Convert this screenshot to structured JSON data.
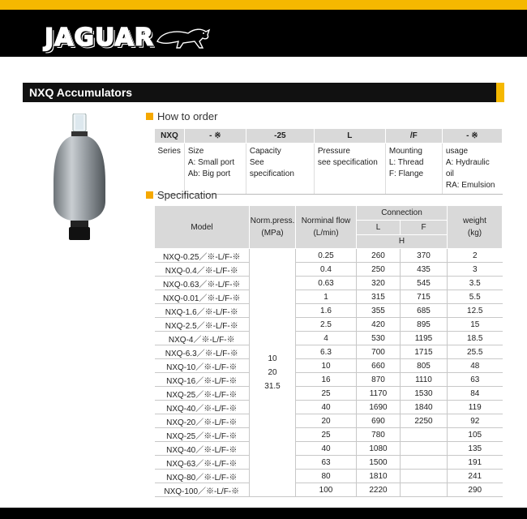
{
  "brand": {
    "logo_text": "JAGUAR"
  },
  "page_title": "NXQ  Accumulators",
  "how_to_order": {
    "heading": "How to order",
    "headers": [
      "NXQ",
      "- ※",
      "-25",
      "L",
      "/F",
      "- ※"
    ],
    "cells": [
      [
        "Series"
      ],
      [
        "Size",
        "A: Small port",
        "Ab: Big port"
      ],
      [
        "Capacity",
        "See specification"
      ],
      [
        "Pressure",
        "see specification"
      ],
      [
        "Mounting",
        "L: Thread",
        "F: Flange"
      ],
      [
        "usage",
        "A: Hydraulic oil",
        "RA: Emulsion"
      ]
    ]
  },
  "specification": {
    "heading": "Specification",
    "col_model": "Model",
    "col_press": "Norm.press.\n(MPa)",
    "col_flow": "Norminal  flow\n(L/min)",
    "col_connection": "Connection",
    "col_L": "L",
    "col_F": "F",
    "col_H": "H",
    "col_weight": "weight\n(kg)",
    "pressures": [
      "10",
      "20",
      "31.5"
    ],
    "rows": [
      {
        "model": "NXQ-0.25／※-L/F-※",
        "flow": "0.25",
        "L": "260",
        "F": "370",
        "w": "2"
      },
      {
        "model": "NXQ-0.4／※-L/F-※",
        "flow": "0.4",
        "L": "250",
        "F": "435",
        "w": "3"
      },
      {
        "model": "NXQ-0.63／※-L/F-※",
        "flow": "0.63",
        "L": "320",
        "F": "545",
        "w": "3.5"
      },
      {
        "model": "NXQ-0.01／※-L/F-※",
        "flow": "1",
        "L": "315",
        "F": "715",
        "w": "5.5"
      },
      {
        "model": "NXQ-1.6／※-L/F-※",
        "flow": "1.6",
        "L": "355",
        "F": "685",
        "w": "12.5"
      },
      {
        "model": "NXQ-2.5／※-L/F-※",
        "flow": "2.5",
        "L": "420",
        "F": "895",
        "w": "15"
      },
      {
        "model": "NXQ-4／※-L/F-※",
        "flow": "4",
        "L": "530",
        "F": "1195",
        "w": "18.5"
      },
      {
        "model": "NXQ-6.3／※-L/F-※",
        "flow": "6.3",
        "L": "700",
        "F": "1715",
        "w": "25.5"
      },
      {
        "model": "NXQ-10／※-L/F-※",
        "flow": "10",
        "L": "660",
        "F": "805",
        "w": "48"
      },
      {
        "model": "NXQ-16／※-L/F-※",
        "flow": "16",
        "L": "870",
        "F": "1110",
        "w": "63"
      },
      {
        "model": "NXQ-25／※-L/F-※",
        "flow": "25",
        "L": "1170",
        "F": "1530",
        "w": "84"
      },
      {
        "model": "NXQ-40／※-L/F-※",
        "flow": "40",
        "L": "1690",
        "F": "1840",
        "w": "119"
      },
      {
        "model": "NXQ-20／※-L/F-※",
        "flow": "20",
        "L": "690",
        "F": "2250",
        "w": "92"
      },
      {
        "model": "NXQ-25／※-L/F-※",
        "flow": "25",
        "L": "780",
        "F": "",
        "w": "105"
      },
      {
        "model": "NXQ-40／※-L/F-※",
        "flow": "40",
        "L": "1080",
        "F": "",
        "w": "135"
      },
      {
        "model": "NXQ-63／※-L/F-※",
        "flow": "63",
        "L": "1500",
        "F": "",
        "w": "191"
      },
      {
        "model": "NXQ-80／※-L/F-※",
        "flow": "80",
        "L": "1810",
        "F": "",
        "w": "241"
      },
      {
        "model": "NXQ-100／※-L/F-※",
        "flow": "100",
        "L": "2220",
        "F": "",
        "w": "290"
      }
    ]
  }
}
